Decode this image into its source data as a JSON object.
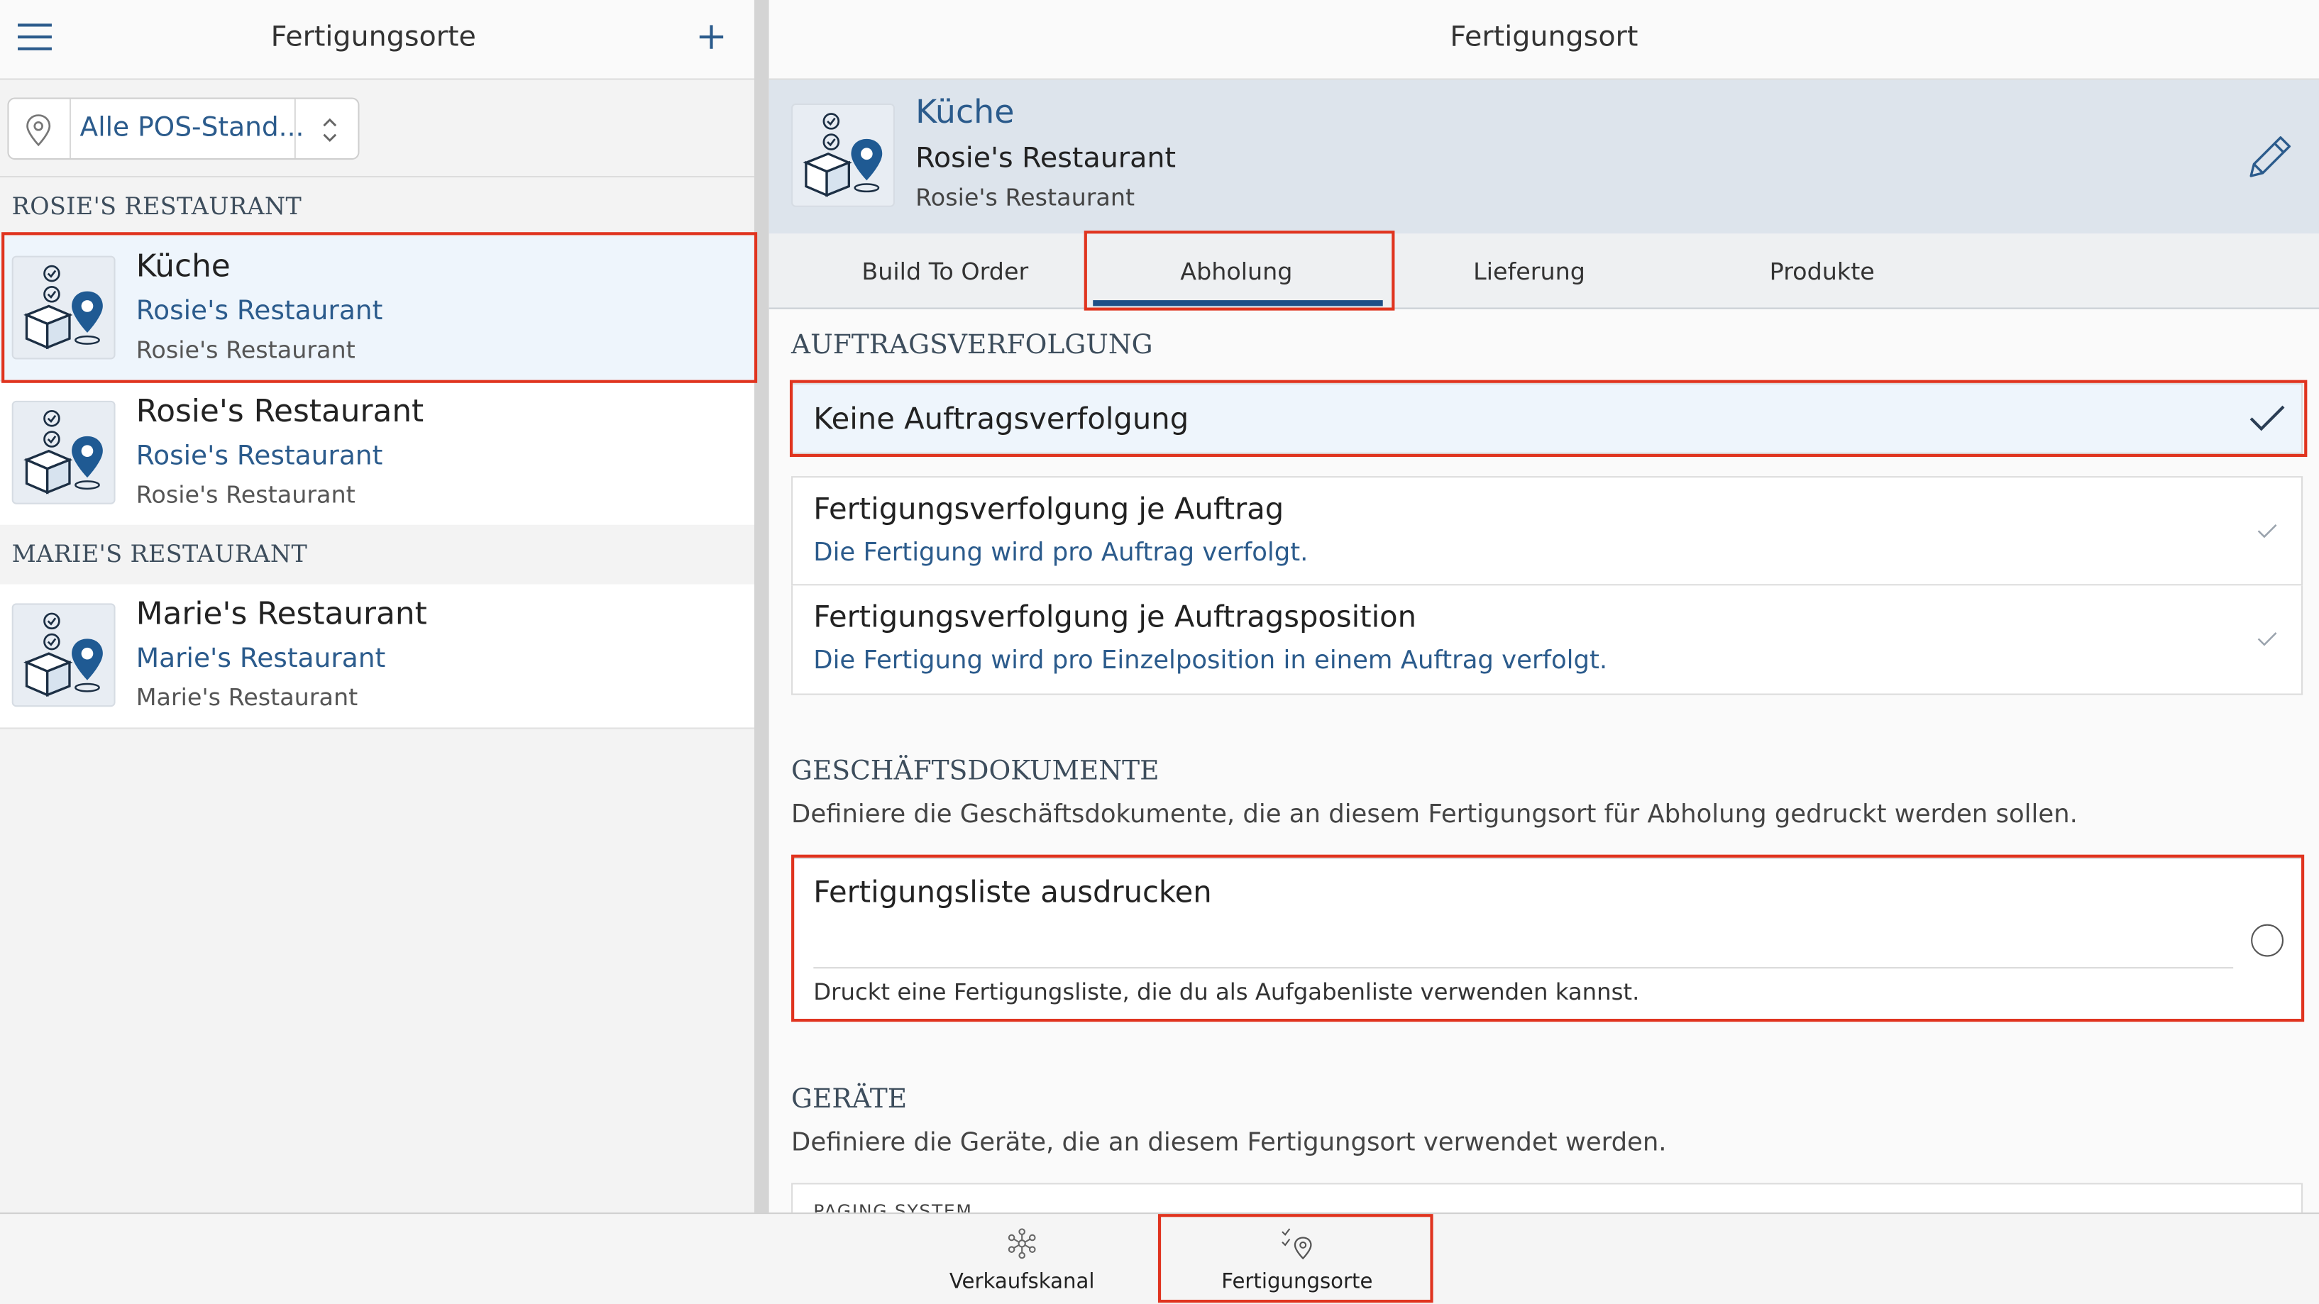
{
  "colors": {
    "accent": "#2b5b8c",
    "annotation_red": "#e0341f",
    "selected_row": "#eef5fc",
    "detail_header": "#dde4ec"
  },
  "left_pane": {
    "title": "Fertigungsorte",
    "menu_icon": "hamburger-menu-icon",
    "add_icon": "plus-icon",
    "location_filter": {
      "icon": "map-pin-icon",
      "value": "Alle POS-Stand...",
      "stepper_icon": "chevron-up-down-icon"
    },
    "groups": [
      {
        "label": "ROSIE'S RESTAURANT",
        "items": [
          {
            "title": "Küche",
            "subtitle": "Rosie's Restaurant",
            "detail": "Rosie's Restaurant",
            "selected": true
          },
          {
            "title": "Rosie's Restaurant",
            "subtitle": "Rosie's Restaurant",
            "detail": "Rosie's Restaurant",
            "selected": false
          }
        ]
      },
      {
        "label": "MARIE'S RESTAURANT",
        "items": [
          {
            "title": "Marie's Restaurant",
            "subtitle": "Marie's Restaurant",
            "detail": "Marie's Restaurant",
            "selected": false
          }
        ]
      }
    ]
  },
  "right_pane": {
    "title": "Fertigungsort",
    "detail": {
      "title": "Küche",
      "subtitle": "Rosie's Restaurant",
      "detail": "Rosie's Restaurant",
      "edit_icon": "pencil-icon"
    },
    "tabs": [
      {
        "label": "Build To Order",
        "active": false
      },
      {
        "label": "Abholung",
        "active": true
      },
      {
        "label": "Lieferung",
        "active": false
      },
      {
        "label": "Produkte",
        "active": false
      }
    ],
    "order_tracking": {
      "heading": "AUFTRAGSVERFOLGUNG",
      "options": [
        {
          "title": "Keine Auftragsverfolgung",
          "description": "",
          "checked": true
        },
        {
          "title": "Fertigungsverfolgung je Auftrag",
          "description": "Die Fertigung wird pro Auftrag verfolgt.",
          "checked": false
        },
        {
          "title": "Fertigungsverfolgung je Auftragsposition",
          "description": "Die Fertigung wird pro Einzelposition in einem Auftrag verfolgt.",
          "checked": false
        }
      ]
    },
    "business_documents": {
      "heading": "GESCHÄFTSDOKUMENTE",
      "description": "Definiere die Geschäftsdokumente, die an diesem Fertigungsort für Abholung gedruckt werden sollen.",
      "print_option": {
        "title": "Fertigungsliste ausdrucken",
        "description": "Druckt eine Fertigungsliste, die du als Aufgabenliste verwenden kannst.",
        "selected": false
      }
    },
    "devices": {
      "heading": "GERÄTE",
      "description": "Definiere die Geräte, die an diesem Fertigungsort verwendet werden.",
      "first_row_label": "PAGING SYSTEM"
    }
  },
  "bottom_bar": {
    "tabs": [
      {
        "label": "Verkaufskanal",
        "icon": "network-nodes-icon",
        "active": false
      },
      {
        "label": "Fertigungsorte",
        "icon": "checklist-pin-icon",
        "active": true
      }
    ]
  }
}
